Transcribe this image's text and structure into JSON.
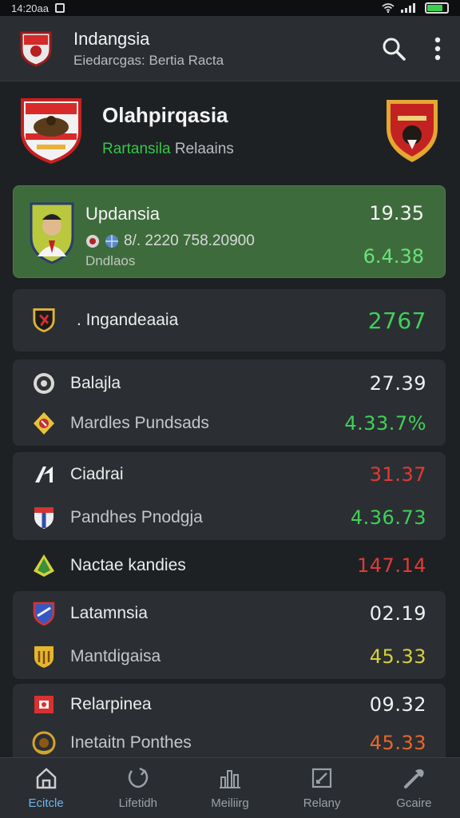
{
  "status_bar": {
    "time": "14:20aa"
  },
  "app_bar": {
    "title": "Indangsia",
    "subtitle": "Eiedarcgas: Bertia Racta"
  },
  "hero": {
    "title": "Olahpirqasia",
    "subtitle_green": "Rartansila",
    "subtitle_rest": " Relaains"
  },
  "featured": {
    "name": "Updansia",
    "detail": "8/. 2220 758.20900",
    "caption": "Dndlaos",
    "value_top": "19.35",
    "value_bottom": "6.4.38"
  },
  "cards": [
    {
      "rows": [
        {
          "label": ". Ingandeaaia",
          "value": "2767",
          "value_color": "green",
          "icon": "shield-dark-icon"
        }
      ]
    },
    {
      "rows": [
        {
          "label": "Balajla",
          "value": "27.39",
          "value_color": "white",
          "icon": "round-crest-icon"
        },
        {
          "label": "Mardles Pundsads",
          "value": "4.33.7%",
          "value_color": "green",
          "icon": "gold-badge-icon"
        }
      ]
    },
    {
      "rows": [
        {
          "label": "Ciadrai",
          "value": "31.37",
          "value_color": "red",
          "icon": "letter-n-icon"
        },
        {
          "label": "Pandhes Pnodgja",
          "value": "4.36.73",
          "value_color": "green",
          "icon": "flag-shield-icon"
        }
      ]
    },
    {
      "rows": [
        {
          "label": "Nactae kandies",
          "value": "147.14",
          "value_color": "red",
          "icon": "green-diamond-icon"
        }
      ]
    },
    {
      "rows": [
        {
          "label": "Latamnsia",
          "value": "02.19",
          "value_color": "white",
          "icon": "blue-shield-icon"
        },
        {
          "label": "Mantdigaisa",
          "value": "45.33",
          "value_color": "yellow",
          "icon": "gold-shield-icon"
        }
      ]
    },
    {
      "rows": [
        {
          "label": "Relarpinea",
          "value": "09.32",
          "value_color": "white",
          "icon": "red-square-icon"
        },
        {
          "label": "Inetaitn Ponthes",
          "value": "45.33",
          "value_color": "orange",
          "icon": "gold-wreath-icon"
        }
      ]
    }
  ],
  "bottom_nav": [
    {
      "label": "Ecitcle",
      "icon": "home-icon",
      "active": true
    },
    {
      "label": "Lifetidh",
      "icon": "refresh-icon",
      "active": false
    },
    {
      "label": "Meiliirg",
      "icon": "chart-icon",
      "active": false
    },
    {
      "label": "Relany",
      "icon": "edit-box-icon",
      "active": false
    },
    {
      "label": "Gcaire",
      "icon": "tools-icon",
      "active": false
    }
  ],
  "colors": {
    "background": "#1e2124",
    "card": "#2b2f33",
    "featured_card": "#3e6b3c",
    "positive": "#3fd157",
    "negative": "#e23a36",
    "accent": "#6fb4e8"
  }
}
